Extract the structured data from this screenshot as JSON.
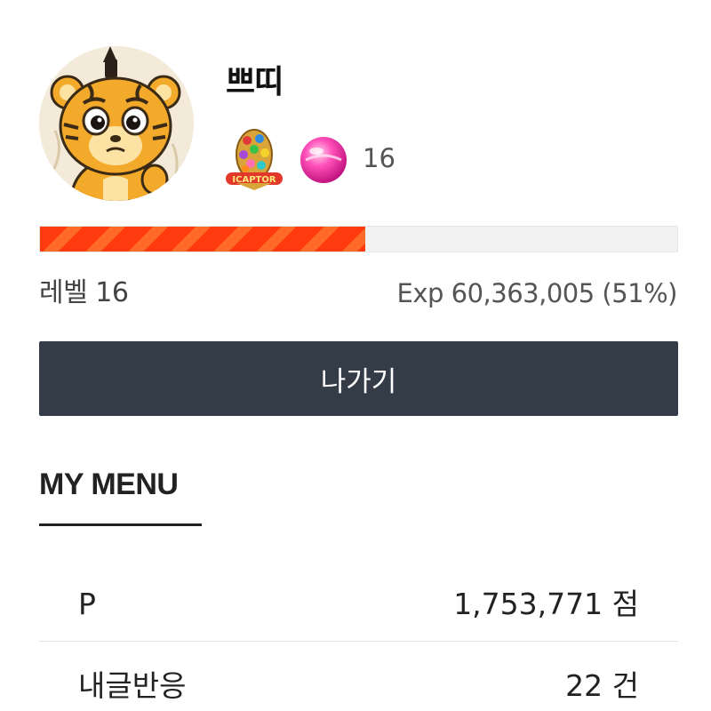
{
  "profile": {
    "username": "쁘띠",
    "badge_count": "16",
    "avatar_icon": "tiger-cub-avatar",
    "badges": [
      "easter-egg-badge-icon",
      "pink-candy-icon"
    ],
    "egg_badge_text": "ICAPTOR"
  },
  "level": {
    "label": "레벨 16",
    "exp_text": "Exp 60,363,005 (51%)",
    "progress_fraction": 0.51,
    "bar_color": "#ff3b0f"
  },
  "exit_button": {
    "label": "나가기",
    "color": "#343d47"
  },
  "my_menu": {
    "title": "MY MENU",
    "items": [
      {
        "label": "P",
        "value": "1,753,771 점"
      },
      {
        "label": "내글반응",
        "value": "22 건"
      }
    ]
  }
}
